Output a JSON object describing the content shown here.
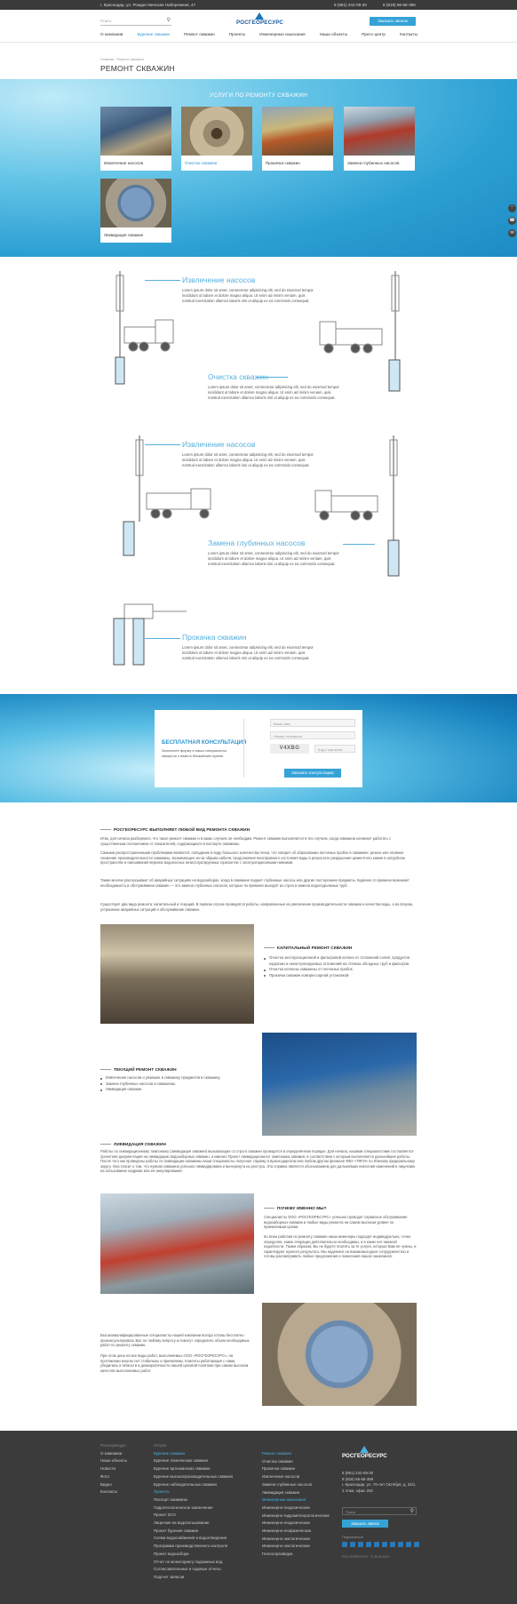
{
  "topbar": {
    "address": "г. Краснодар, ул. Рождественская Набережная, 47",
    "phone1": "8 (861) 242-09-30",
    "phone2": "8 (918) 66-66-396"
  },
  "header": {
    "search_placeholder": "Поиск",
    "logo_text": "РОСГЕОРЕСУРС",
    "order_button": "Заказать звонок"
  },
  "nav": [
    "О компании",
    "Бурение скважин",
    "Ремонт скважин",
    "Проекты",
    "Инженерные изыскания",
    "Наши объекты",
    "Пресс-центр",
    "Контакты"
  ],
  "breadcrumb": {
    "home": "Главная",
    "current": "Ремонт скважин"
  },
  "page_title": "РЕМОНТ СКВАЖИН",
  "services": {
    "title": "УСЛУГИ ПО РЕМОНТУ СКВАЖИН",
    "cards": [
      "Извлечение насосов",
      "Очистка скважин",
      "Прокачка скважин",
      "Замена глубинных насосов",
      "Ликвидация скважин"
    ]
  },
  "steps": [
    {
      "title": "Извлечение насосов",
      "text": "Lorem ipsum dolor sit amet, consectetur adipisicing elit, sed do eiusmod tempor incididunt ut labore et dolore magna aliqua. Ut enim ad minim veniam, quis nostrud exercitation ullamco laboris nisi ut aliquip ex ea commodo consequat."
    },
    {
      "title": "Очистка скважин",
      "text": "Lorem ipsum dolor sit amet, consectetur adipisicing elit, sed do eiusmod tempor incididunt ut labore et dolore magna aliqua. Ut enim ad minim veniam, quis nostrud exercitation ullamco laboris nisi ut aliquip ex ea commodo consequat."
    },
    {
      "title": "Извлечение насосов",
      "text": "Lorem ipsum dolor sit amet, consectetur adipisicing elit, sed do eiusmod tempor incididunt ut labore et dolore magna aliqua. Ut enim ad minim veniam, quis nostrud exercitation ullamco laboris nisi ut aliquip ex ea commodo consequat."
    },
    {
      "title": "Замена глубинных насосов",
      "text": "Lorem ipsum dolor sit amet, consectetur adipisicing elit, sed do eiusmod tempor incididunt ut labore et dolore magna aliqua. Ut enim ad minim veniam, quis nostrud exercitation ullamco laboris nisi ut aliquip ex ea commodo consequat."
    },
    {
      "title": "Прокачка скважин",
      "text": "Lorem ipsum dolor sit amet, consectetur adipisicing elit, sed do eiusmod tempor incididunt ut labore et dolore magna aliqua. Ut enim ad minim veniam, quis nostrud exercitation ullamco laboris nisi ut aliquip ex ea commodo consequat."
    }
  ],
  "consult": {
    "title": "БЕСПЛАТНАЯ КОНСУЛЬТАЦИЯ",
    "subtitle": "Заполните форму и наши специалисты свяжутся с вами в ближайшее время",
    "name_ph": "Ваше имя",
    "phone_ph": "Номер телефона",
    "captcha": "V4XBG",
    "captcha_ph": "Код с картинки",
    "submit": "Заказать консультацию"
  },
  "article": {
    "h1": "РОСГЕОРЕСУРС ВЫПОЛНЯЕТ ЛЮБОЙ ВИД РЕМОНТА СКВАЖИН",
    "p1": "Итак, для начала разберемся, что такое ремонт скважин и в каких случаях он необходим. Ремонт скважин выполняется в тех случаях, когда скважина начинает работать с существенным отклонением от показателей, содержащихся в паспорте скважины.",
    "p2": "Самыми распространенными проблемами являются: попадание в воду большого количества песка, что говорит об образовании песчаных пробок в скважине; резкое или плавное снижение производительности скважины, возникающее из-за обрыва кабеля, продолжения неисправного состояния воды в результате разрушения цементного камня в затрубном пространстве и смешивания верхних водоносных неэксплуатируемых горизонтов с эксплуатационными нижними.",
    "p3": "Также многие рассказывают об аварийных ситуациях на водозаборах, когда в скважине падают глубинные насосы или другие посторонние предметы. Бурение от времени возникает необходимость в обслуживании скважин — это замена глубинных насосов, которые по времени выходят из строя и замена водоподъемных труб.",
    "p4": "Существует два вида ремонта: капитальный и текущий. В первом случае проводятся работы, направленные на увеличение производительности скважин и качества воды, а во втором, устранение аварийных ситуаций и обслуживание скважин.",
    "h2": "КАПИТАЛЬНЫЙ РЕМОНТ СКВАЖИН",
    "list2": [
      "Очистка эксплуатационной и фильтровой колонн от отложений солей, продуктов коррозии и неконтролируемых отложений на стенках обсадных труб и фильтров.",
      "Очистка колонны скважины от песчаных пробок.",
      "Прокачка скважин компрессорной установкой."
    ],
    "h3": "ТЕКУЩИЙ РЕМОНТ СКВАЖИН",
    "list3": [
      "Извлечение насосов и упавших в скважину предметов в скважину.",
      "Замена глубинных насосов в скважинах.",
      "Ликвидация скважин."
    ],
    "h4": "ЛИКВИДАЦИЯ СКВАЖИН",
    "p5": "Работы по ликвидационному тампонажу (ликвидация скважин) вызывающих со строго скважин проводятся в определённом порядке. Для начала, нашими специалистами составляется проектная документация на ликвидацию водозаборных скважин, а именно Проект ликвидационного тампонажа скважин, в соответствии с которым выполняются дальнейшие работы. После того как проведены работы по ликвидации скважины наши специалисты получают справку в Краснодарском или любом другом филиале ФБУ «ТФГИ» по Южному федеральному округу. Она гласит о том, что нужная скважина успешно ликвидирована и вычеркнута из реестра. Эта справка является обоснованием для дальнейших внесения изменений в лицензию на пользование недрами или её аннулирования.",
    "h5": "ПОЧЕМУ ИМЕННО МЫ?",
    "p6": "Специалисты ООО «РОСГЕОРЕСУРС» успешно проводят сервисное обслуживание водозаборных скважин и любые виды ремонта на самом высоком уровне по приемлемым ценам.",
    "p7": "Ко всем работам по ремонту скважин наши инженеры подходят индивидуально, точно определяя, какие операции действительно необходимы, а в каких нет никакой надобности. Таким образом, Вы не будете платить за те услуги, которые Вам не нужны, и гарантируют нужного результата. Мы надеемся на взаимовыгодное сотрудничество и готовы рассматривать любые предложения и пожелания наших заказчиков.",
    "p8": "Высококвалифицированные специалисты нашей компании всегда готовы бесплатно проконсультировать Вас по любому вопросу и помогут определить объем необходимых работ по ремонту скважин.",
    "p9": "При этом цена на все виды работ, выполняемых ООО «РОСГЕОРЕСУРС», на протяжении многих лет стабильны и приемлемы. Клиенты работающие с нами, убедились в гибкости и демократичности нашей ценовой политики при самом высоком качестве выполняемых работ."
  },
  "footer": {
    "col1_head": "Росгеоресурс",
    "col1": [
      "О компании",
      "Наши объекты",
      "Новости",
      "Фото",
      "Видео",
      "Контакты"
    ],
    "col2_head": "Услуги",
    "col2_blue": "Бурение скважин",
    "col2": [
      "Бурение технических скважин",
      "Бурение артезианских скважин",
      "Бурение высокопроизводительных скважин",
      "Бурение наблюдательных скважин"
    ],
    "col2_blue2": "Проекты",
    "col2b": [
      "Паспорт скважины",
      "Гидрогеологическое заключение",
      "Проект ЗСО",
      "Лицензия на водопользование",
      "Проект бурения скважин",
      "Схема водоснабжения и водоотведения",
      "Программа производственного контроля",
      "Проект водозабора",
      "Отчет по мониторингу подземных вод",
      "Согласовательные и годовые отчеты",
      "Подсчет запасов"
    ],
    "col3_blue": "Ремонт скважин",
    "col3": [
      "Очистка скважин",
      "Прокачка скважин",
      "Извлечение насосов",
      "Замена глубинных насосов",
      "Ликвидация скважин"
    ],
    "col3_blue2": "Инженерные изыскания",
    "col3b": [
      "Инженерно-геодезические",
      "Инженерно-гидрометеорологические",
      "Инженерно-геодезические",
      "Инженерно-геофизические",
      "Инженерно-экологические",
      "Инженерно-экологические",
      "Геологоразведка"
    ],
    "logo_text": "РОСГЕОРЕСУРС",
    "phone1": "8 (861) 242-09-30",
    "phone2": "8 (918) 66-66-396",
    "address": "г. Краснодар, ул. 70-лет Октября, д. 34/1, 2 этаж, офис 202",
    "search_ph": "Поиск",
    "order_button": "Заказать звонок",
    "subscribe": "Подписаться",
    "copyright": "РОСГЕОРЕСУРС · © 2015-2021"
  }
}
